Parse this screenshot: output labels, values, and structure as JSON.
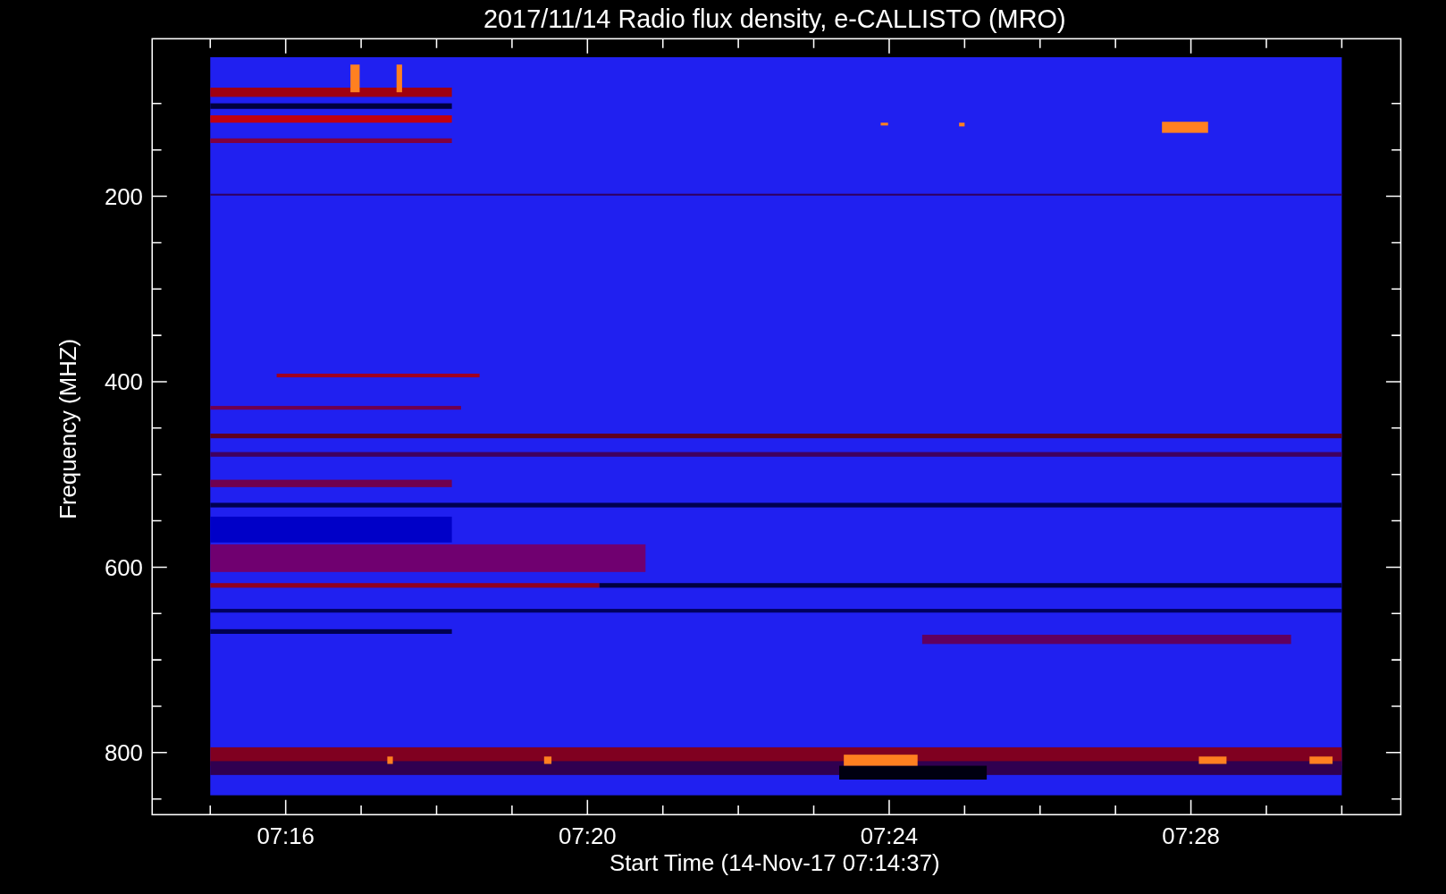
{
  "plot": {
    "title": "2017/11/14  Radio flux density, e-CALLISTO (MRO)",
    "xlabel": "Start Time (14-Nov-17 07:14:37)",
    "ylabel": "Frequency (MHZ)",
    "xtick_labels": [
      "07:16",
      "07:20",
      "07:24",
      "07:28"
    ],
    "ytick_labels": [
      "200",
      "400",
      "600",
      "800"
    ]
  }
}
